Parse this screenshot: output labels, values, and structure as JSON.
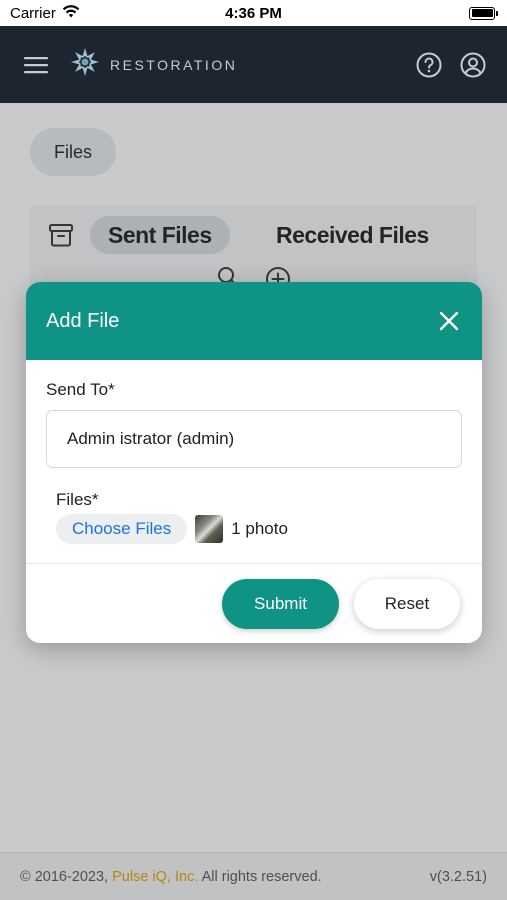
{
  "status_bar": {
    "carrier": "Carrier",
    "time": "4:36 PM",
    "icons": [
      "wifi-icon",
      "battery-icon"
    ]
  },
  "navbar": {
    "brand_name": "RESTORATION",
    "icons": [
      "hamburger-menu-icon",
      "brand-logo-icon",
      "help-icon",
      "user-account-icon"
    ]
  },
  "page": {
    "files_chip": "Files",
    "tabs": {
      "sent": "Sent Files",
      "received": "Received Files"
    }
  },
  "modal": {
    "title": "Add File",
    "send_to_label": "Send To*",
    "send_to_value": "Admin istrator (admin)",
    "files_label": "Files*",
    "choose_files_label": "Choose Files",
    "file_count": "1 photo",
    "submit_label": "Submit",
    "reset_label": "Reset"
  },
  "footer": {
    "copyright_prefix": "© 2016-2023,",
    "company": "Pulse iQ, Inc.",
    "copyright_suffix": "All rights reserved.",
    "version": "v(3.2.51)"
  },
  "colors": {
    "accent": "#0f9384",
    "navbar": "#1d2530",
    "link": "#1a73e8",
    "company_link": "#e0a400"
  }
}
